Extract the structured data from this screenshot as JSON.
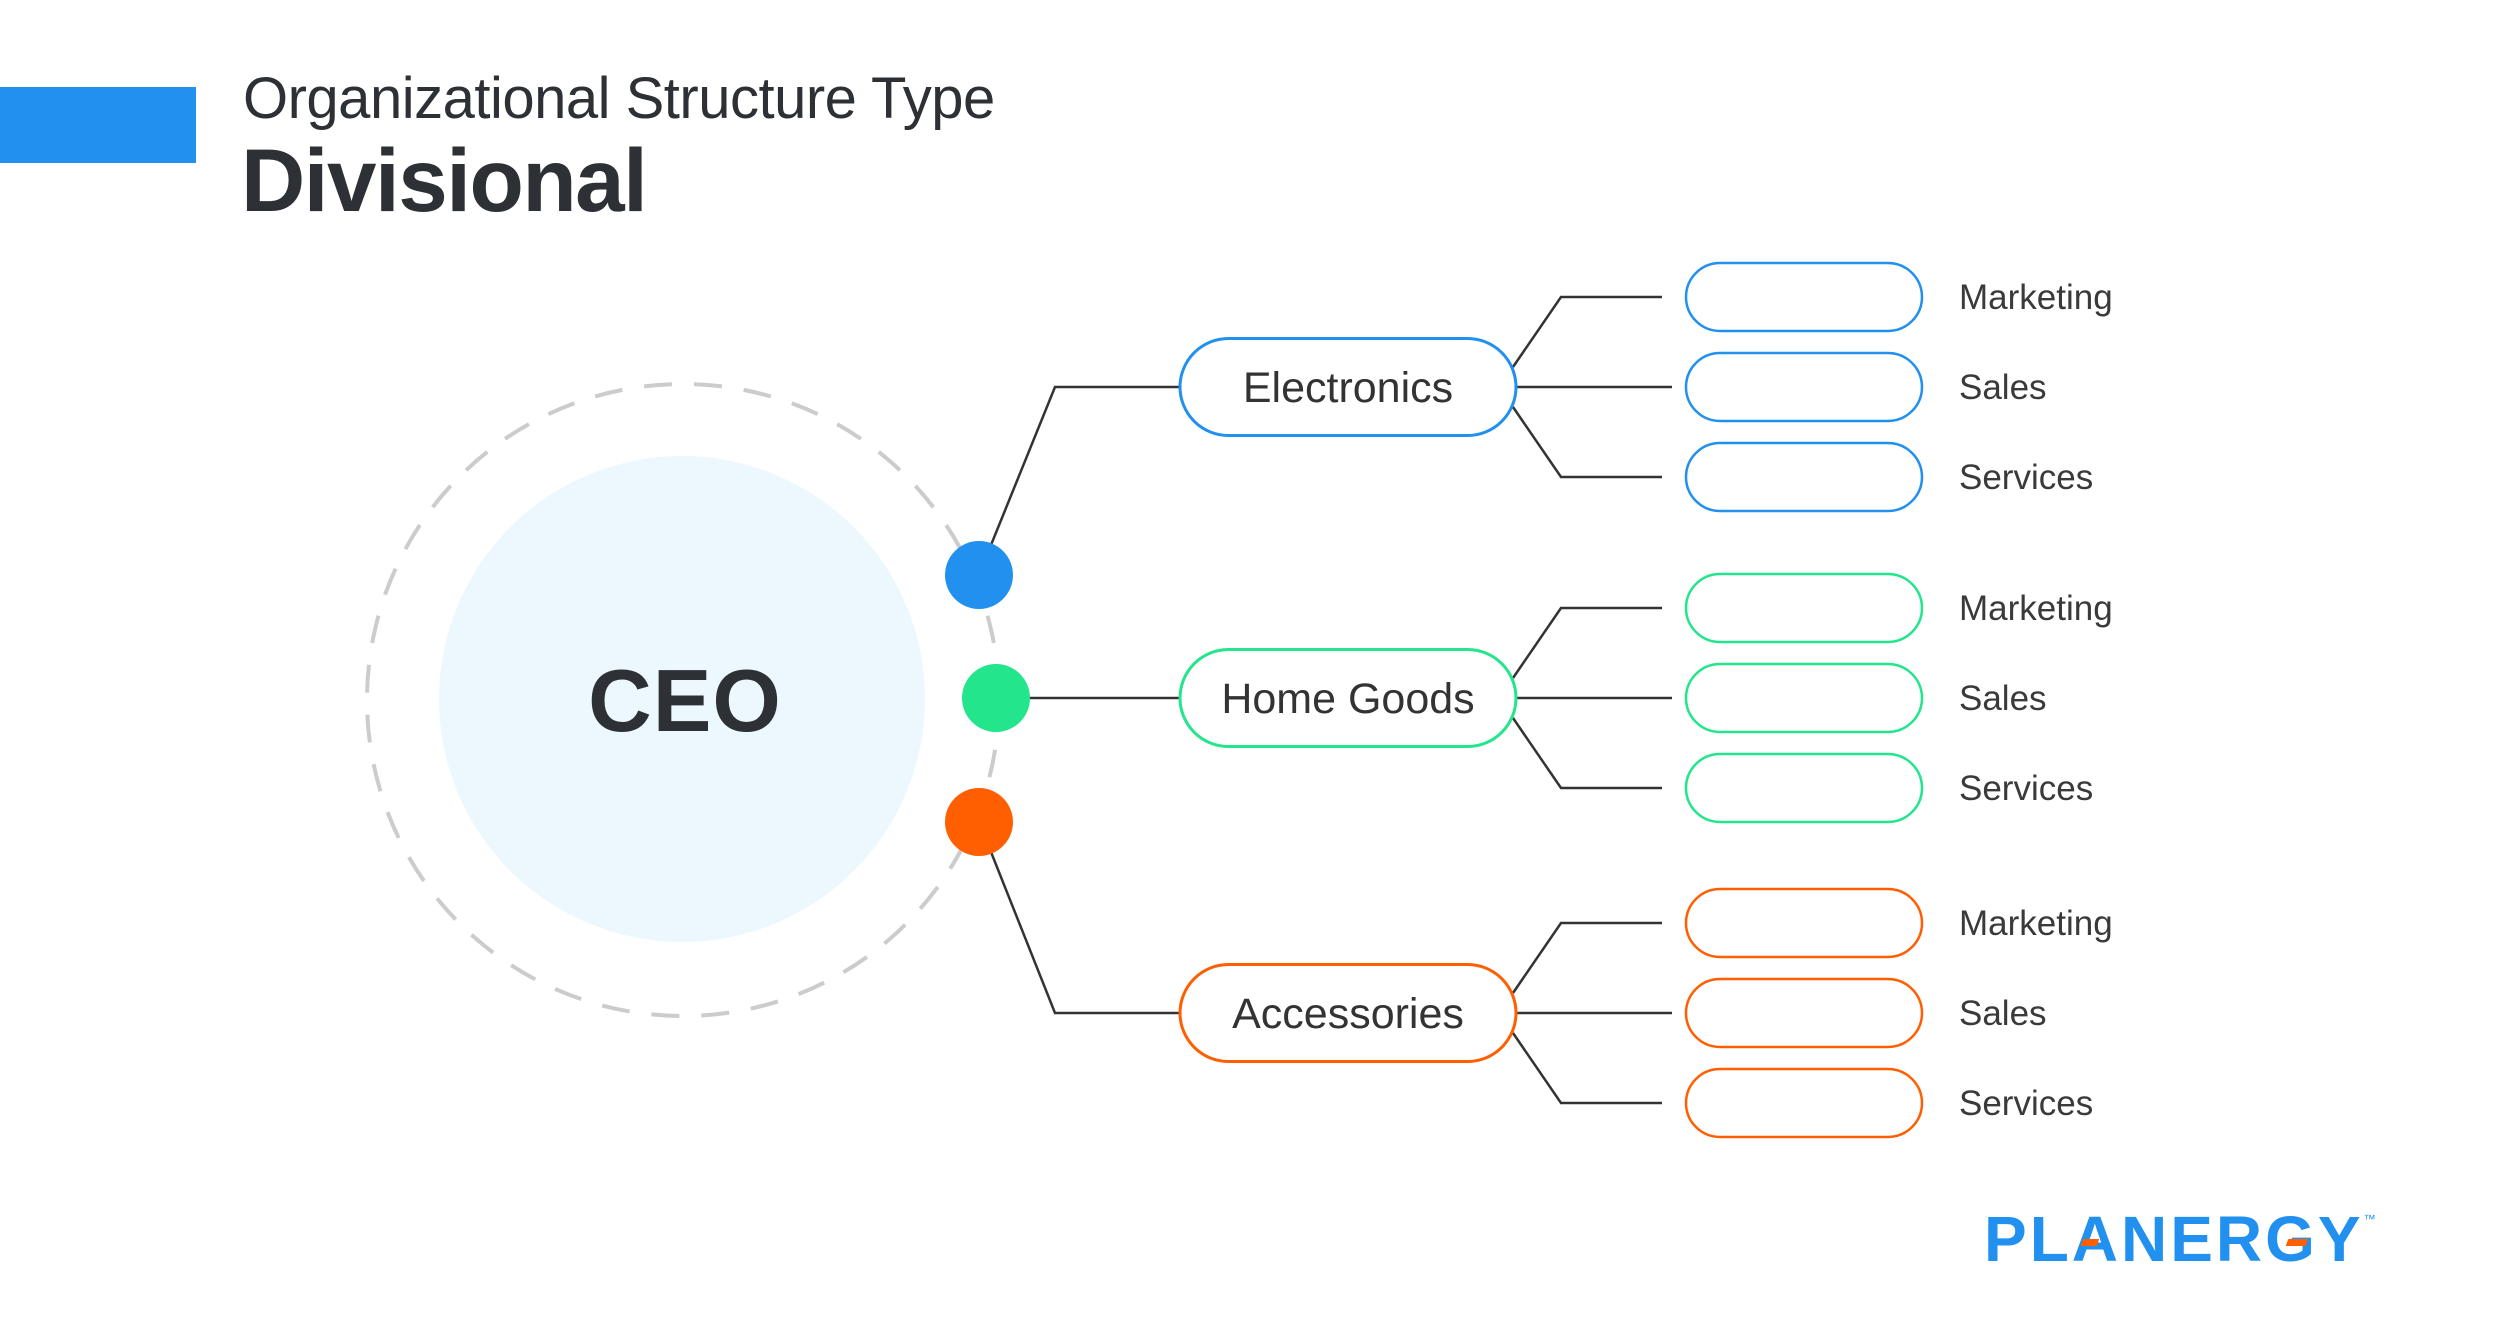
{
  "header": {
    "subtitle": "Organizational Structure Type",
    "title": "Divisional"
  },
  "colors": {
    "accent_bar": "#2190EE",
    "text": "#2d3035",
    "ceo_fill": "#EDF7FE",
    "dashed_ring": "#CCCCCC",
    "connector": "#333333"
  },
  "root": {
    "label": "CEO"
  },
  "divisions": [
    {
      "label": "Electronics",
      "color": "#2190EE",
      "departments": [
        "Marketing",
        "Sales",
        "Services"
      ]
    },
    {
      "label": "Home Goods",
      "color": "#22E58C",
      "departments": [
        "Marketing",
        "Sales",
        "Services"
      ]
    },
    {
      "label": "Accessories",
      "color": "#FF5F00",
      "departments": [
        "Marketing",
        "Sales",
        "Services"
      ]
    }
  ],
  "logo": {
    "text": "PLANERGY",
    "trademark": "™",
    "color": "#2190EE",
    "accent_color": "#FF5F00"
  }
}
